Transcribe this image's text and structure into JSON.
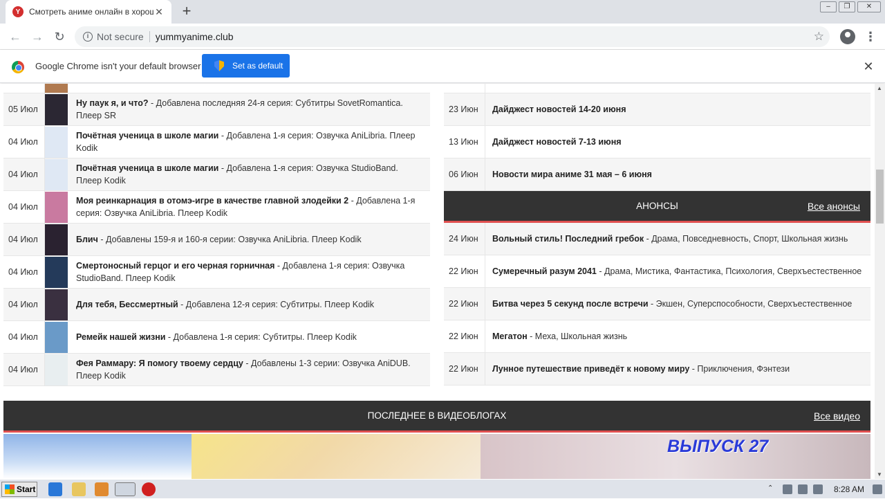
{
  "browser": {
    "tab_title": "Смотреть аниме онлайн в хороше",
    "tab_close": "✕",
    "new_tab": "+",
    "security_label": "Not secure",
    "url": "yummyanime.club"
  },
  "infobar": {
    "message": "Google Chrome isn't your default browser",
    "button_label": "Set as default",
    "close": "✕"
  },
  "updates": [
    {
      "date": "05 Июл",
      "title": "Ну паук я, и что?",
      "desc": " - Добавлена последняя 24-я серия: Субтитры SovetRomantica. Плеер SR",
      "thumb_color": "#2b2733"
    },
    {
      "date": "04 Июл",
      "title": "Почётная ученица в школе магии",
      "desc": " - Добавлена 1-я серия: Озвучка AniLibria. Плеер Kodik",
      "thumb_color": "#dfe8f4"
    },
    {
      "date": "04 Июл",
      "title": "Почётная ученица в школе магии",
      "desc": " - Добавлена 1-я серия: Озвучка StudioBand. Плеер Kodik",
      "thumb_color": "#dfe8f4"
    },
    {
      "date": "04 Июл",
      "title": "Моя реинкарнация в отомэ-игре в качестве главной злодейки 2",
      "desc": " - Добавлена 1-я серия: Озвучка AniLibria. Плеер Kodik",
      "thumb_color": "#c97aa0"
    },
    {
      "date": "04 Июл",
      "title": "Блич",
      "desc": " - Добавлены 159-я и 160-я серии: Озвучка AniLibria. Плеер Kodik",
      "thumb_color": "#2a2230"
    },
    {
      "date": "04 Июл",
      "title": "Смертоносный герцог и его черная горничная",
      "desc": " - Добавлена 1-я серия: Озвучка StudioBand. Плеер Kodik",
      "thumb_color": "#243a5a"
    },
    {
      "date": "04 Июл",
      "title": "Для тебя, Бессмертный",
      "desc": " - Добавлена 12-я серия: Субтитры. Плеер Kodik",
      "thumb_color": "#3a3040"
    },
    {
      "date": "04 Июл",
      "title": "Ремейк нашей жизни",
      "desc": " - Добавлена 1-я серия: Субтитры. Плеер Kodik",
      "thumb_color": "#6a9ac8"
    },
    {
      "date": "04 Июл",
      "title": "Фея Раммару: Я помогу твоему сердцу",
      "desc": " - Добавлены 1-3 серии: Озвучка AniDUB. Плеер Kodik",
      "thumb_color": "#e8eef0"
    }
  ],
  "news": [
    {
      "date": "23 Июн",
      "title": "Дайджест новостей 14-20 июня",
      "desc": ""
    },
    {
      "date": "13 Июн",
      "title": "Дайджест новостей 7-13 июня",
      "desc": ""
    },
    {
      "date": "06 Июн",
      "title": "Новости мира аниме 31 мая – 6 июня",
      "desc": ""
    }
  ],
  "announcements": {
    "heading": "АНОНСЫ",
    "more": "Все анонсы",
    "items": [
      {
        "date": "24 Июн",
        "title": "Вольный стиль! Последний гребок",
        "desc": " - Драма, Повседневность, Спорт, Школьная жизнь"
      },
      {
        "date": "22 Июн",
        "title": "Сумеречный разум 2041",
        "desc": " - Драма, Мистика, Фантастика, Психология, Сверхъестественное"
      },
      {
        "date": "22 Июн",
        "title": "Битва через 5 секунд после встречи",
        "desc": " - Экшен, Суперспособности, Сверхъестественное"
      },
      {
        "date": "22 Июн",
        "title": "Мегатон",
        "desc": " - Меха, Школьная жизнь"
      },
      {
        "date": "22 Июн",
        "title": "Лунное путешествие приведёт к новому миру",
        "desc": " - Приключения, Фэнтези"
      }
    ]
  },
  "videoblogs": {
    "heading": "ПОСЛЕДНЕЕ В ВИДЕОБЛОГАХ",
    "more": "Все видео",
    "episode_label": "ВЫПУСК 27"
  },
  "taskbar": {
    "start": "Start",
    "clock": "8:28 AM"
  }
}
